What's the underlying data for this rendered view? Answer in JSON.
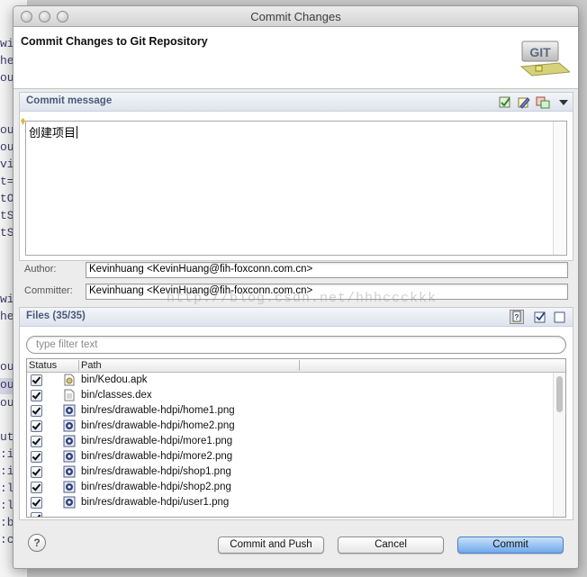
{
  "window": {
    "title": "Commit Changes"
  },
  "header": {
    "title": "Commit Changes to Git Repository",
    "logo_text": "GIT"
  },
  "commit_section": {
    "title": "Commit message",
    "message": "创建项目"
  },
  "author": {
    "label": "Author:",
    "value": "Kevinhuang <KevinHuang@fih-foxconn.com.cn>"
  },
  "committer": {
    "label": "Committer:",
    "value": "Kevinhuang <KevinHuang@fih-foxconn.com.cn>"
  },
  "files_section": {
    "title": "Files (35/35)",
    "filter_placeholder": "type filter text"
  },
  "table": {
    "columns": [
      "Status",
      "Path"
    ],
    "rows": [
      {
        "path": "bin/Kedou.apk",
        "icon": "apk-file-icon",
        "checked": true
      },
      {
        "path": "bin/classes.dex",
        "icon": "file-icon",
        "checked": true
      },
      {
        "path": "bin/res/drawable-hdpi/home1.png",
        "icon": "image-file-icon",
        "checked": true
      },
      {
        "path": "bin/res/drawable-hdpi/home2.png",
        "icon": "image-file-icon",
        "checked": true
      },
      {
        "path": "bin/res/drawable-hdpi/more1.png",
        "icon": "image-file-icon",
        "checked": true
      },
      {
        "path": "bin/res/drawable-hdpi/more2.png",
        "icon": "image-file-icon",
        "checked": true
      },
      {
        "path": "bin/res/drawable-hdpi/shop1.png",
        "icon": "image-file-icon",
        "checked": true
      },
      {
        "path": "bin/res/drawable-hdpi/shop2.png",
        "icon": "image-file-icon",
        "checked": true
      },
      {
        "path": "bin/res/drawable-hdpi/user1.png",
        "icon": "image-file-icon",
        "checked": true
      }
    ]
  },
  "buttons": {
    "help": "?",
    "commit_and_push": "Commit and Push",
    "cancel": "Cancel",
    "commit": "Commit"
  },
  "watermark": "http://blog.csdn.net/hhhccckkk",
  "background_editor": {
    "lines": [
      "wi",
      "he",
      "ou",
      "ou",
      "ou",
      "vi",
      "t=",
      "tO",
      "tS",
      "tS",
      "wi",
      "he",
      "ou",
      "ou",
      "ou",
      "ut",
      ":i",
      ":i",
      ":l",
      ":l",
      ":b",
      ":c"
    ]
  }
}
